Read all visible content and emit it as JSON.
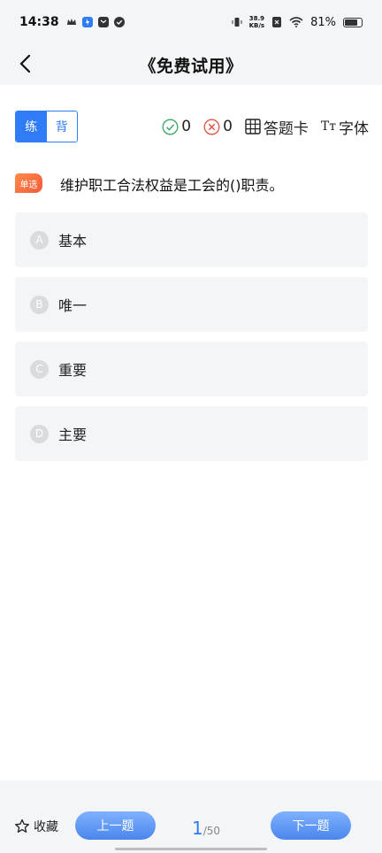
{
  "status_bar": {
    "time": "14:38",
    "net_speed_value": "38.9",
    "net_speed_unit": "KB/s",
    "battery": "81%"
  },
  "header": {
    "title": "《免费试用》"
  },
  "mode": {
    "practice": "练",
    "recite": "背"
  },
  "stats": {
    "correct": "0",
    "wrong": "0",
    "answer_card": "答题卡",
    "font": "字体",
    "font_icon_text": "Tт"
  },
  "question": {
    "type": "单选",
    "text": "维护职工合法权益是工会的()职责。",
    "options": [
      {
        "letter": "A",
        "text": "基本"
      },
      {
        "letter": "B",
        "text": "唯一"
      },
      {
        "letter": "C",
        "text": "重要"
      },
      {
        "letter": "D",
        "text": "主要"
      }
    ]
  },
  "footer": {
    "favorite": "收藏",
    "prev": "上一题",
    "next": "下一题",
    "current": "1",
    "total": "/50"
  },
  "colors": {
    "accent": "#2f7cf6",
    "badge": "#f25a3b",
    "option_bg": "#f4f5f7"
  }
}
